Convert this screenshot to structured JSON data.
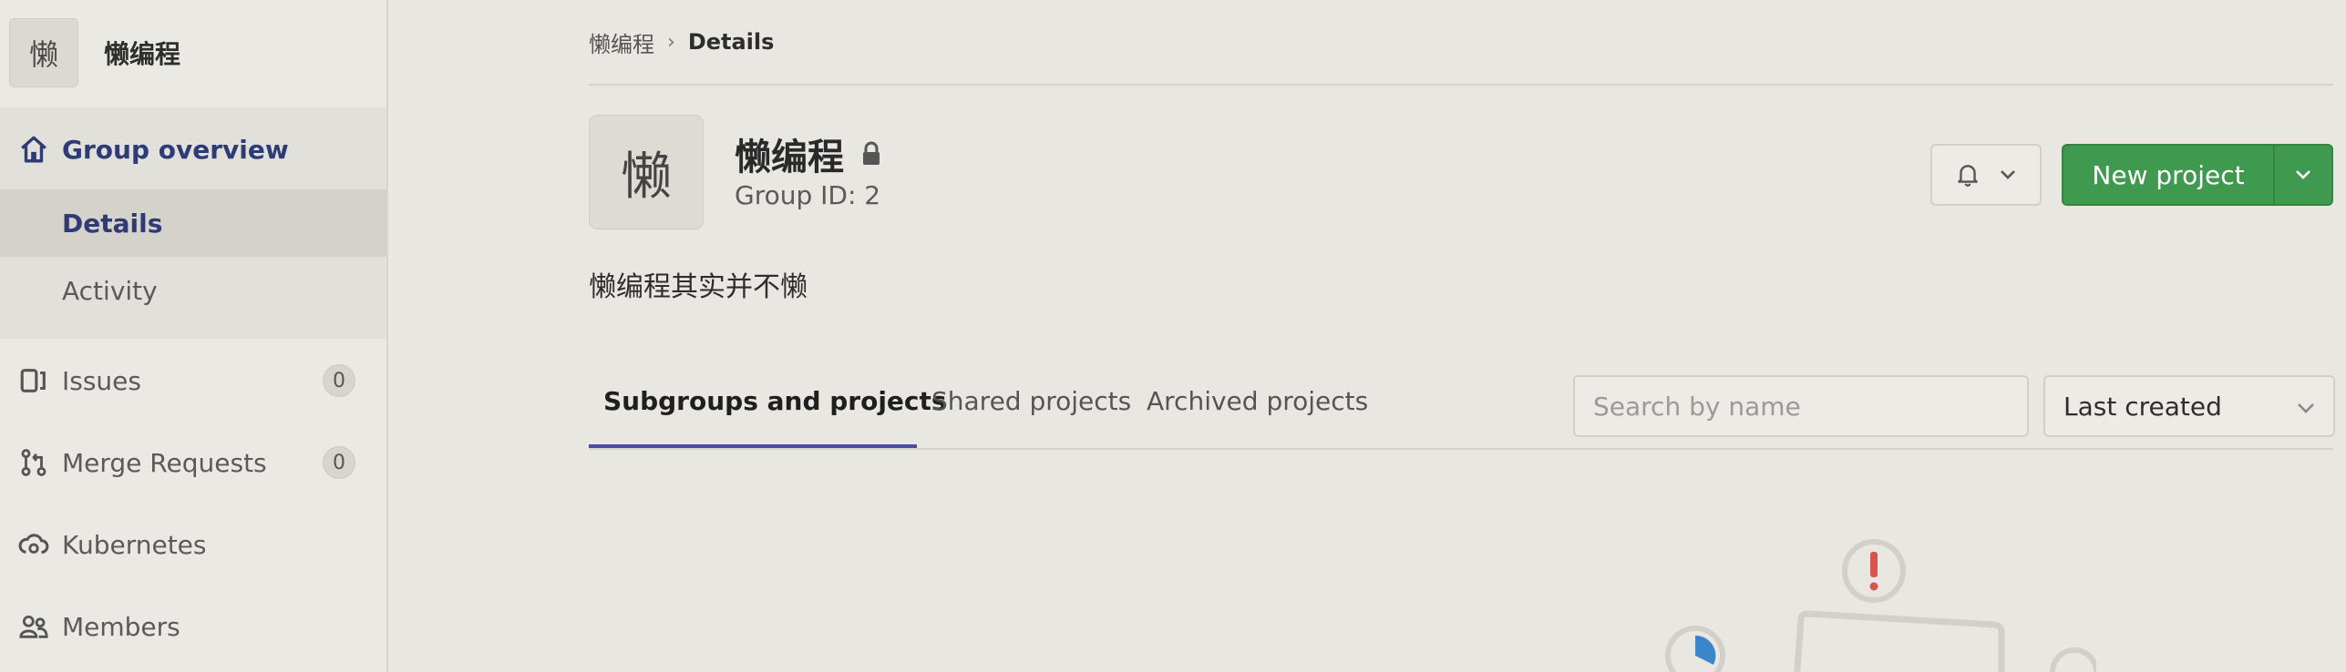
{
  "sidebar": {
    "group_avatar_letter": "懒",
    "group_name": "懒编程",
    "overview_label": "Group overview",
    "details_label": "Details",
    "activity_label": "Activity",
    "items": [
      {
        "label": "Issues",
        "count": "0",
        "icon": "issues-icon"
      },
      {
        "label": "Merge Requests",
        "count": "0",
        "icon": "merge-request-icon"
      },
      {
        "label": "Kubernetes",
        "icon": "kubernetes-icon"
      },
      {
        "label": "Members",
        "icon": "members-icon"
      }
    ]
  },
  "breadcrumb": {
    "root": "懒编程",
    "separator": "›",
    "current": "Details"
  },
  "group": {
    "avatar_letter": "懒",
    "name": "懒编程",
    "id_text": "Group ID: 2",
    "description": "懒编程其实并不懒",
    "visibility_icon": "lock-icon"
  },
  "actions": {
    "notification_icon": "bell-icon",
    "new_project_label": "New project"
  },
  "tabs": [
    {
      "label": "Subgroups and projects",
      "active": true
    },
    {
      "label": "Shared projects",
      "active": false
    },
    {
      "label": "Archived projects",
      "active": false
    }
  ],
  "filters": {
    "search_placeholder": "Search by name",
    "sort_value": "Last created"
  },
  "colors": {
    "accent": "#3f9a50",
    "tab_active": "#4b4ba8",
    "nav_active": "#2f3b74",
    "alert": "#d9534f"
  }
}
